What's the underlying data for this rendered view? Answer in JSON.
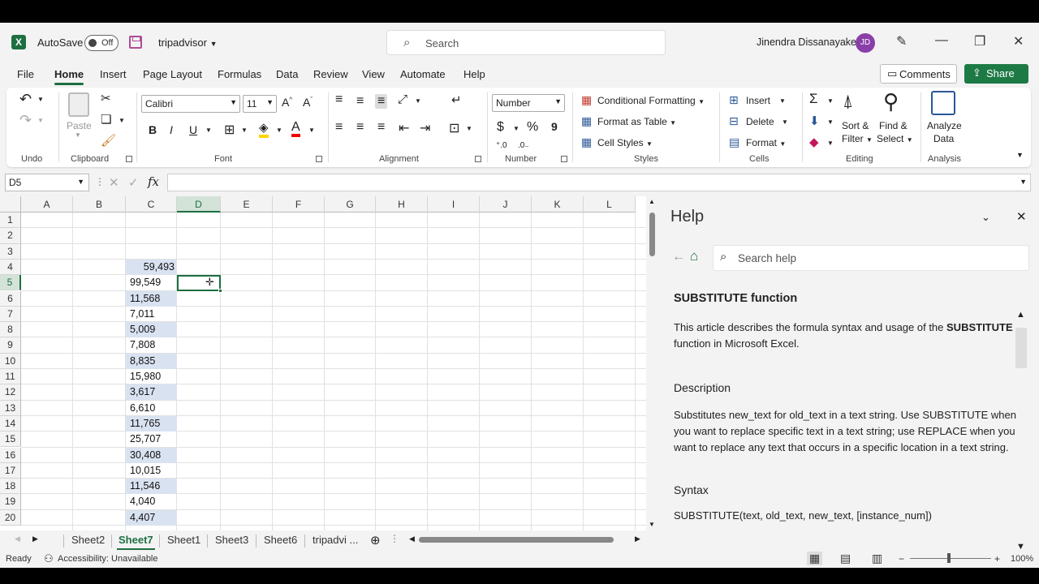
{
  "titlebar": {
    "app_logo": "X",
    "autosave_label": "AutoSave",
    "autosave_state": "Off",
    "document_name": "tripadvisor",
    "search_placeholder": "Search",
    "user_name": "Jinendra Dissanayake",
    "user_initials": "JD"
  },
  "tabs": [
    "File",
    "Home",
    "Insert",
    "Page Layout",
    "Formulas",
    "Data",
    "Review",
    "View",
    "Automate",
    "Help"
  ],
  "active_tab": "Home",
  "header_buttons": {
    "comments": "Comments",
    "share": "Share"
  },
  "ribbon": {
    "groups": {
      "undo": "Undo",
      "clipboard": "Clipboard",
      "font": "Font",
      "alignment": "Alignment",
      "number": "Number",
      "styles": "Styles",
      "cells": "Cells",
      "editing": "Editing",
      "analysis": "Analysis"
    },
    "paste": "Paste",
    "font_name": "Calibri",
    "font_size": "11",
    "number_format": "Number",
    "conditional_formatting": "Conditional Formatting",
    "format_as_table": "Format as Table",
    "cell_styles": "Cell Styles",
    "insert": "Insert",
    "delete": "Delete",
    "format": "Format",
    "sort_filter_1": "Sort &",
    "sort_filter_2": "Filter",
    "find_select_1": "Find &",
    "find_select_2": "Select",
    "analyze_1": "Analyze",
    "analyze_2": "Data",
    "bold": "B",
    "italic": "I",
    "underline": "U",
    "currency": "$",
    "percent": "%",
    "comma": "9"
  },
  "formula_bar": {
    "name_box": "D5",
    "fx": "fx",
    "content": ""
  },
  "sheet": {
    "columns": [
      "A",
      "B",
      "C",
      "D",
      "E",
      "F",
      "G",
      "H",
      "I",
      "J",
      "K",
      "L"
    ],
    "rows": [
      "1",
      "2",
      "3",
      "4",
      "5",
      "6",
      "7",
      "8",
      "9",
      "10",
      "11",
      "12",
      "13",
      "14",
      "15",
      "16",
      "17",
      "18",
      "19",
      "20"
    ],
    "selected_column": "D",
    "selected_row": "5",
    "c_values": [
      {
        "row": 4,
        "value": "59,493",
        "highlight": true,
        "align": "right"
      },
      {
        "row": 5,
        "value": "99,549",
        "highlight": false,
        "align": "left"
      },
      {
        "row": 6,
        "value": "11,568",
        "highlight": true,
        "align": "left"
      },
      {
        "row": 7,
        "value": "7,011",
        "highlight": false,
        "align": "left"
      },
      {
        "row": 8,
        "value": "5,009",
        "highlight": true,
        "align": "left"
      },
      {
        "row": 9,
        "value": "7,808",
        "highlight": false,
        "align": "left"
      },
      {
        "row": 10,
        "value": "8,835",
        "highlight": true,
        "align": "left"
      },
      {
        "row": 11,
        "value": "15,980",
        "highlight": false,
        "align": "left"
      },
      {
        "row": 12,
        "value": "3,617",
        "highlight": true,
        "align": "left"
      },
      {
        "row": 13,
        "value": "6,610",
        "highlight": false,
        "align": "left"
      },
      {
        "row": 14,
        "value": "11,765",
        "highlight": true,
        "align": "left"
      },
      {
        "row": 15,
        "value": "25,707",
        "highlight": false,
        "align": "left"
      },
      {
        "row": 16,
        "value": "30,408",
        "highlight": true,
        "align": "left"
      },
      {
        "row": 17,
        "value": "10,015",
        "highlight": false,
        "align": "left"
      },
      {
        "row": 18,
        "value": "11,546",
        "highlight": true,
        "align": "left"
      },
      {
        "row": 19,
        "value": "4,040",
        "highlight": false,
        "align": "left"
      },
      {
        "row": 20,
        "value": "4,407",
        "highlight": true,
        "align": "left"
      }
    ]
  },
  "sheet_tabs": [
    "Sheet2",
    "Sheet7",
    "Sheet1",
    "Sheet3",
    "Sheet6",
    "tripadvi ..."
  ],
  "active_sheet": "Sheet7",
  "help": {
    "title": "Help",
    "search_placeholder": "Search help",
    "heading": "SUBSTITUTE function",
    "intro_1": "This article describes the formula syntax and usage of the ",
    "intro_bold": "SUBSTITUTE",
    "intro_2": " function in Microsoft Excel.",
    "description_heading": "Description",
    "description": "Substitutes new_text for old_text in a text string. Use SUBSTITUTE when you want to replace specific text in a text string; use REPLACE when you want to replace any text that occurs in a specific location in a text string.",
    "syntax_heading": "Syntax",
    "syntax": "SUBSTITUTE(text, old_text, new_text, [instance_num])"
  },
  "status": {
    "ready": "Ready",
    "accessibility": "Accessibility: Unavailable",
    "zoom": "100%"
  },
  "colors": {
    "accent": "#1d6f42",
    "highlight": "#d9e2f1"
  }
}
